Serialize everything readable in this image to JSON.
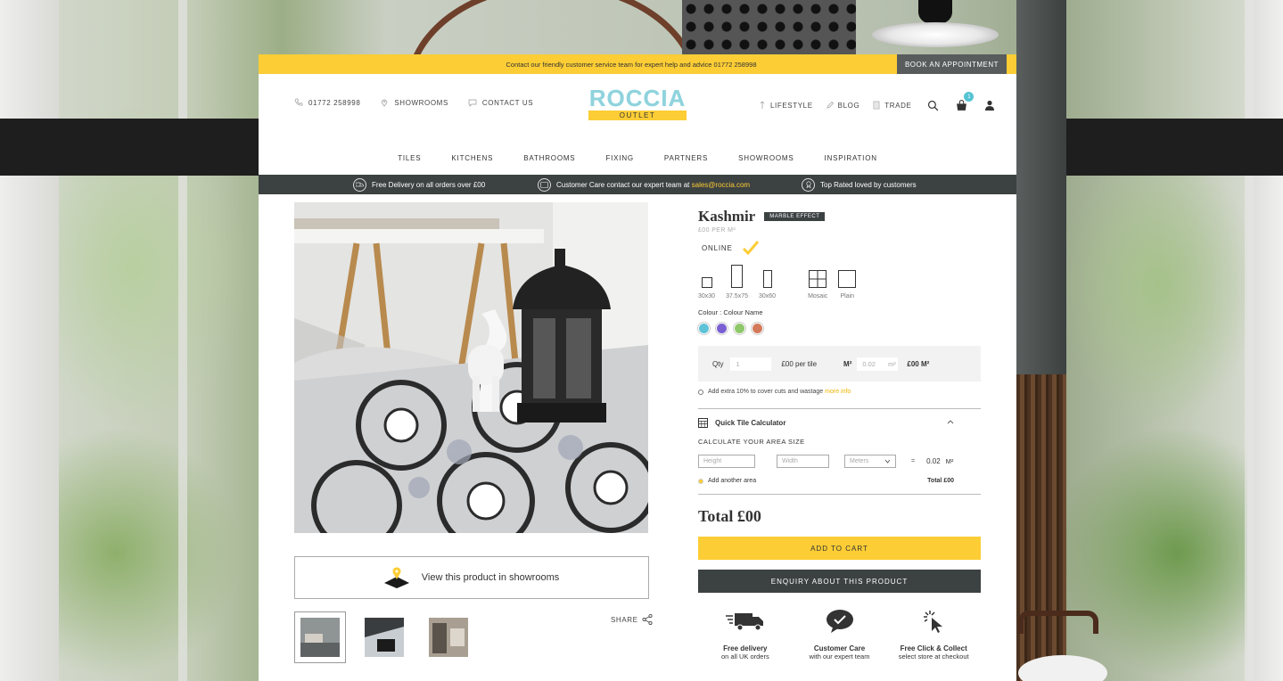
{
  "topbar": {
    "message": "Contact our friendly customer service team for expert help and advice 01772 258998",
    "book_label": "BOOK AN APPOINTMENT"
  },
  "header": {
    "phone": "01772 258998",
    "showrooms": "SHOWROOMS",
    "contact": "CONTACT US",
    "logo_word": "ROCCIA",
    "logo_sub": "OUTLET",
    "lifestyle": "LIFESTYLE",
    "blog": "BLOG",
    "trade": "TRADE",
    "basket_count": "1"
  },
  "nav": [
    "TILES",
    "KITCHENS",
    "BATHROOMS",
    "FIXING",
    "PARTNERS",
    "SHOWROOMS",
    "INSPIRATION"
  ],
  "usp": {
    "delivery": "Free Delivery on all orders over £00",
    "care_prefix": "Customer Care contact our expert team at ",
    "care_email": "sales@roccia.com",
    "rated": "Top Rated loved by customers"
  },
  "product": {
    "name": "Kashmir",
    "tag": "MARBLE EFFECT",
    "price_per": "£00 PER M²",
    "availability": "ONLINE",
    "sizes": [
      "30x30",
      "37.5x75",
      "30x60",
      "Mosaic",
      "Plain"
    ],
    "colour_label": "Colour : Colour Name",
    "colours": [
      "#5fc3d8",
      "#7a5fd2",
      "#8fc86a",
      "#d47a5c"
    ]
  },
  "qty": {
    "label": "Qty",
    "value": "1",
    "per_tile": "£00 per tile",
    "m2_label": "M²",
    "m2_value": "0.02",
    "m2_unit": "m²",
    "price_m2": "£00 M²"
  },
  "extra": {
    "text": "Add extra 10% to cover cuts and wastage ",
    "link": "more info"
  },
  "calculator": {
    "title": "Quick Tile Calculator",
    "subtitle": "CALCULATE YOUR AREA SIZE",
    "height_placeholder": "Height",
    "width_placeholder": "Width",
    "unit": "Meters",
    "equals": "=",
    "result": "0.02",
    "result_unit": "M²",
    "add_area": "Add another area",
    "total": "Total £00"
  },
  "total": "Total £00",
  "buttons": {
    "add_to_cart": "ADD TO CART",
    "enquiry": "ENQUIRY ABOUT THIS PRODUCT",
    "showroom": "View this product in showrooms",
    "share": "SHARE"
  },
  "features": [
    {
      "title": "Free delivery",
      "sub": "on all UK orders"
    },
    {
      "title": "Customer Care",
      "sub": "with our expert team"
    },
    {
      "title": "Free Click & Collect",
      "sub": "select store at checkout"
    }
  ]
}
